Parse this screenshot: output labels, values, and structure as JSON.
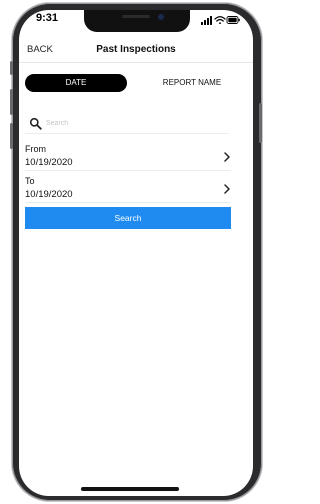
{
  "status_bar": {
    "time": "9:31",
    "icons": [
      "signal-icon",
      "wifi-icon",
      "battery-icon"
    ]
  },
  "nav": {
    "back_label": "BACK",
    "title": "Past Inspections"
  },
  "segment": {
    "options": [
      "DATE",
      "REPORT NAME"
    ],
    "selected": "DATE"
  },
  "search": {
    "placeholder": "Search",
    "value": ""
  },
  "from": {
    "label": "From",
    "value": "10/19/2020"
  },
  "to": {
    "label": "To",
    "value": "10/19/2020"
  },
  "search_button": {
    "label": "Search"
  },
  "colors": {
    "accent": "#1f8bf0",
    "segment_selected": "#000000"
  }
}
